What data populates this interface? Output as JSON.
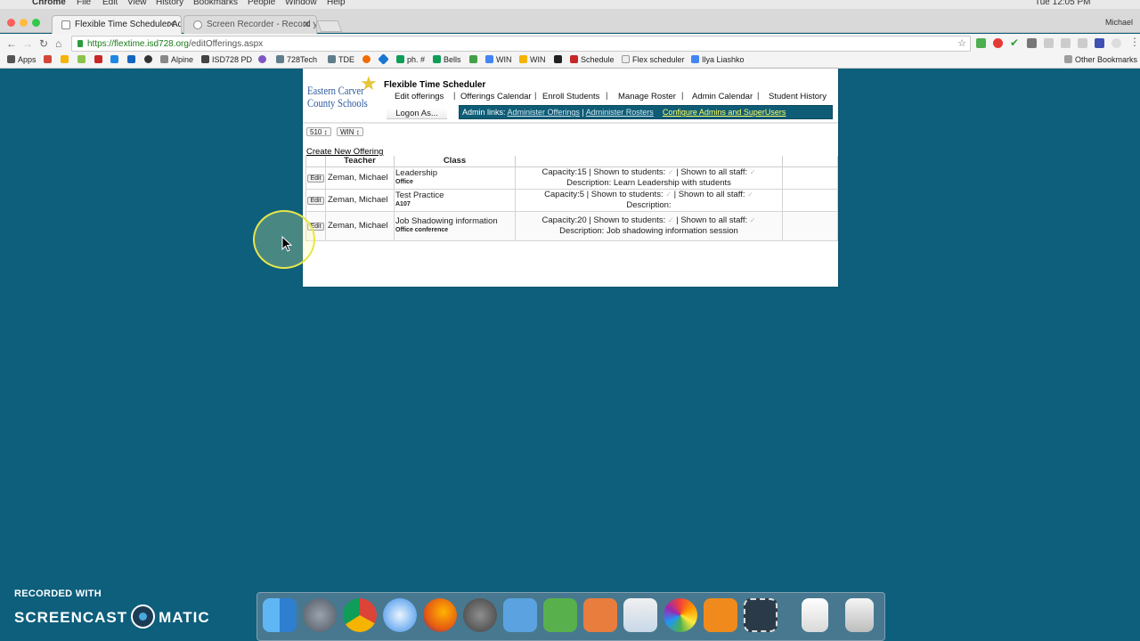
{
  "os_menu": {
    "items": [
      "Chrome",
      "File",
      "Edit",
      "View",
      "History",
      "Bookmarks",
      "People",
      "Window",
      "Help"
    ],
    "clock": "Tue 12:05 PM"
  },
  "browser": {
    "tabs": [
      {
        "title": "Flexible Time Scheduler Admi",
        "active": true
      },
      {
        "title": "Screen Recorder - Record you",
        "active": false
      }
    ],
    "user": "Michael",
    "url_scheme": "https://",
    "url_host": "flextime.isd728.org",
    "url_path": "/editOfferings.aspx",
    "bookmarks": [
      "Apps",
      "Alpine",
      "ISD728 PD",
      "728Tech",
      "TDE",
      "ph. #",
      "Bells",
      "WIN",
      "WIN",
      "Schedule",
      "Flex scheduler",
      "Ilya Liashko"
    ],
    "other_bookmarks": "Other Bookmarks"
  },
  "app": {
    "logo_line1": "Eastern Carver",
    "logo_line2": "County Schools",
    "title": "Flexible Time Scheduler",
    "nav": [
      "Edit offerings",
      "Offerings Calendar",
      "Enroll Students",
      "Manage Roster",
      "Admin Calendar",
      "Student History"
    ],
    "logon_as": "Logon As...",
    "admin_label": "Admin links:",
    "admin_links": [
      "Administer Offerings",
      "Administer Rosters"
    ],
    "admin_config": "Configure Admins and SuperUsers",
    "filters": [
      "510 ↕",
      "WIN ↕"
    ],
    "create_link": "Create New Offering",
    "table_headers": {
      "teacher": "Teacher",
      "class": "Class"
    },
    "edit_label": "Edit",
    "rows": [
      {
        "teacher": "Zeman, Michael",
        "class": "Leadership",
        "room": "Office",
        "capacity": "Capacity:15",
        "students": "Shown to students:",
        "staff": "Shown to all staff:",
        "description": "Description: Learn Leadership with students"
      },
      {
        "teacher": "Zeman, Michael",
        "class": "Test Practice",
        "room": "A107",
        "capacity": "Capacity:5",
        "students": "Shown to students:",
        "staff": "Shown to all staff:",
        "description": "Description:"
      },
      {
        "teacher": "Zeman, Michael",
        "class": "Job Shadowing information",
        "room": "Office conference",
        "capacity": "Capacity:20",
        "students": "Shown to students:",
        "staff": "Shown to all staff:",
        "description": "Description: Job shadowing information session"
      }
    ]
  },
  "watermark": {
    "line1": "RECORDED WITH",
    "brand_left": "SCREENCAST",
    "brand_right": "MATIC"
  },
  "colors": {
    "desktop": "#0d5f7c",
    "admin_bar": "#0f5c76",
    "highlight_link": "#ffff66",
    "cursor_ring": "#e6e64a"
  }
}
